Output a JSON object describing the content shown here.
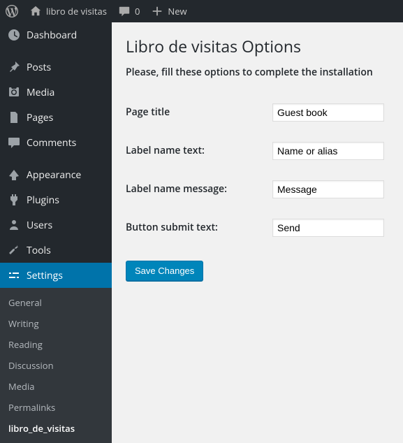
{
  "topbar": {
    "site_name": "libro de visitas",
    "comments_count": "0",
    "new_label": "New"
  },
  "sidebar": {
    "items": [
      {
        "label": "Dashboard"
      },
      {
        "label": "Posts"
      },
      {
        "label": "Media"
      },
      {
        "label": "Pages"
      },
      {
        "label": "Comments"
      },
      {
        "label": "Appearance"
      },
      {
        "label": "Plugins"
      },
      {
        "label": "Users"
      },
      {
        "label": "Tools"
      },
      {
        "label": "Settings"
      }
    ],
    "submenu": [
      {
        "label": "General"
      },
      {
        "label": "Writing"
      },
      {
        "label": "Reading"
      },
      {
        "label": "Discussion"
      },
      {
        "label": "Media"
      },
      {
        "label": "Permalinks"
      },
      {
        "label": "libro_de_visitas"
      }
    ]
  },
  "page": {
    "title": "Libro de visitas Options",
    "subtitle": "Please, fill these options to complete the installation",
    "fields": {
      "page_title": {
        "label": "Page title",
        "value": "Guest book"
      },
      "label_name_text": {
        "label": "Label name text:",
        "value": "Name or alias"
      },
      "label_name_message": {
        "label": "Label name message:",
        "value": "Message"
      },
      "button_submit_text": {
        "label": "Button submit text:",
        "value": "Send"
      }
    },
    "save_label": "Save Changes"
  }
}
